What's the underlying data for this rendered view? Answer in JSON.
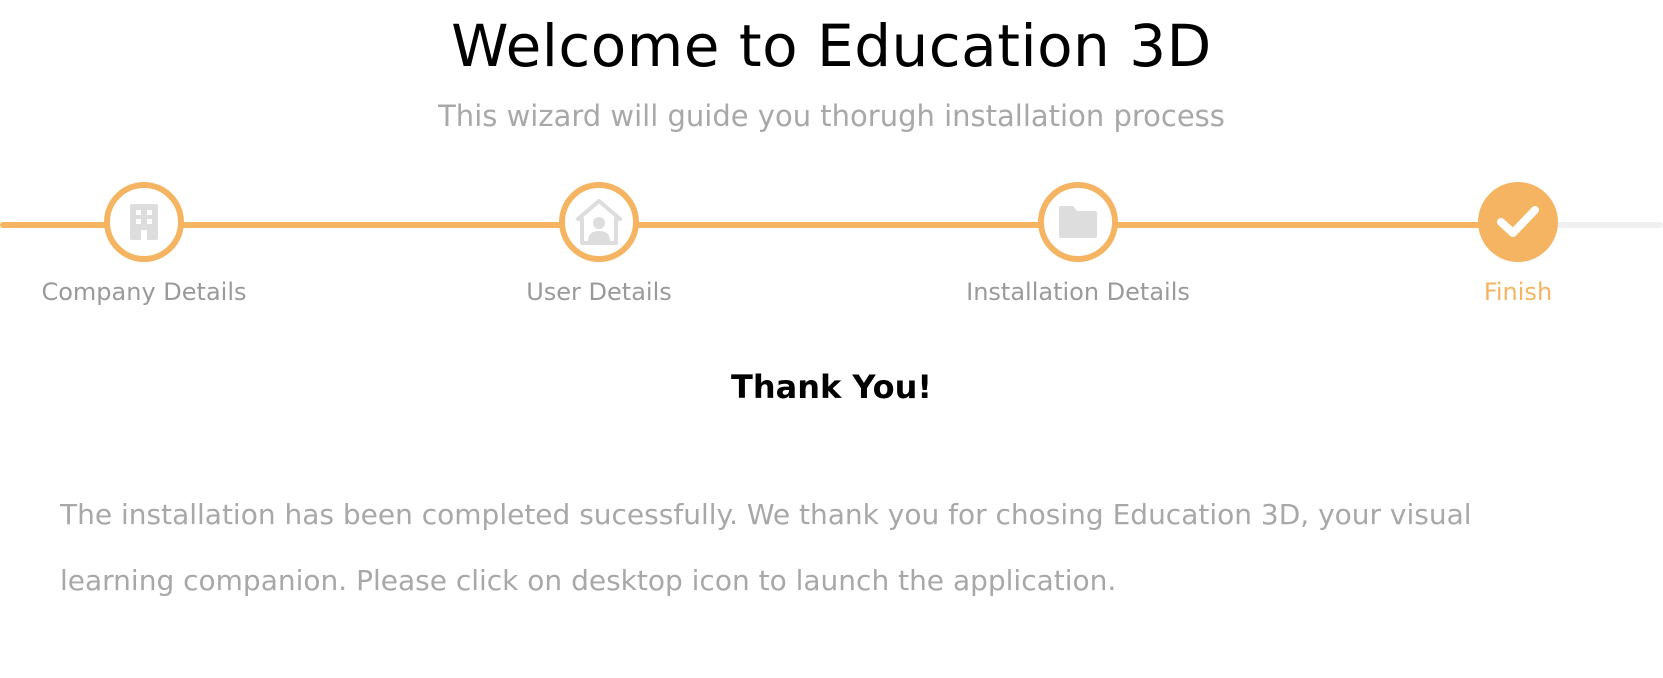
{
  "header": {
    "title": "Welcome to Education 3D",
    "subtitle": "This wizard will guide you thorugh installation process"
  },
  "colors": {
    "accent": "#f5b461",
    "track_inactive": "#f0f0f0",
    "icon_inactive": "#dddddd",
    "label_inactive": "#9a9a9a",
    "body_text": "#a8a8a8"
  },
  "steps": [
    {
      "label": "Company Details",
      "icon": "building-icon",
      "state": "completed"
    },
    {
      "label": "User Details",
      "icon": "house-user-icon",
      "state": "completed"
    },
    {
      "label": "Installation Details",
      "icon": "folder-icon",
      "state": "completed"
    },
    {
      "label": "Finish",
      "icon": "check-icon",
      "state": "active"
    }
  ],
  "content": {
    "heading": "Thank You!",
    "message": "The installation has been completed sucessfully. We thank you for chosing Education 3D, your visual learning companion. Please click on desktop icon to launch the application."
  }
}
